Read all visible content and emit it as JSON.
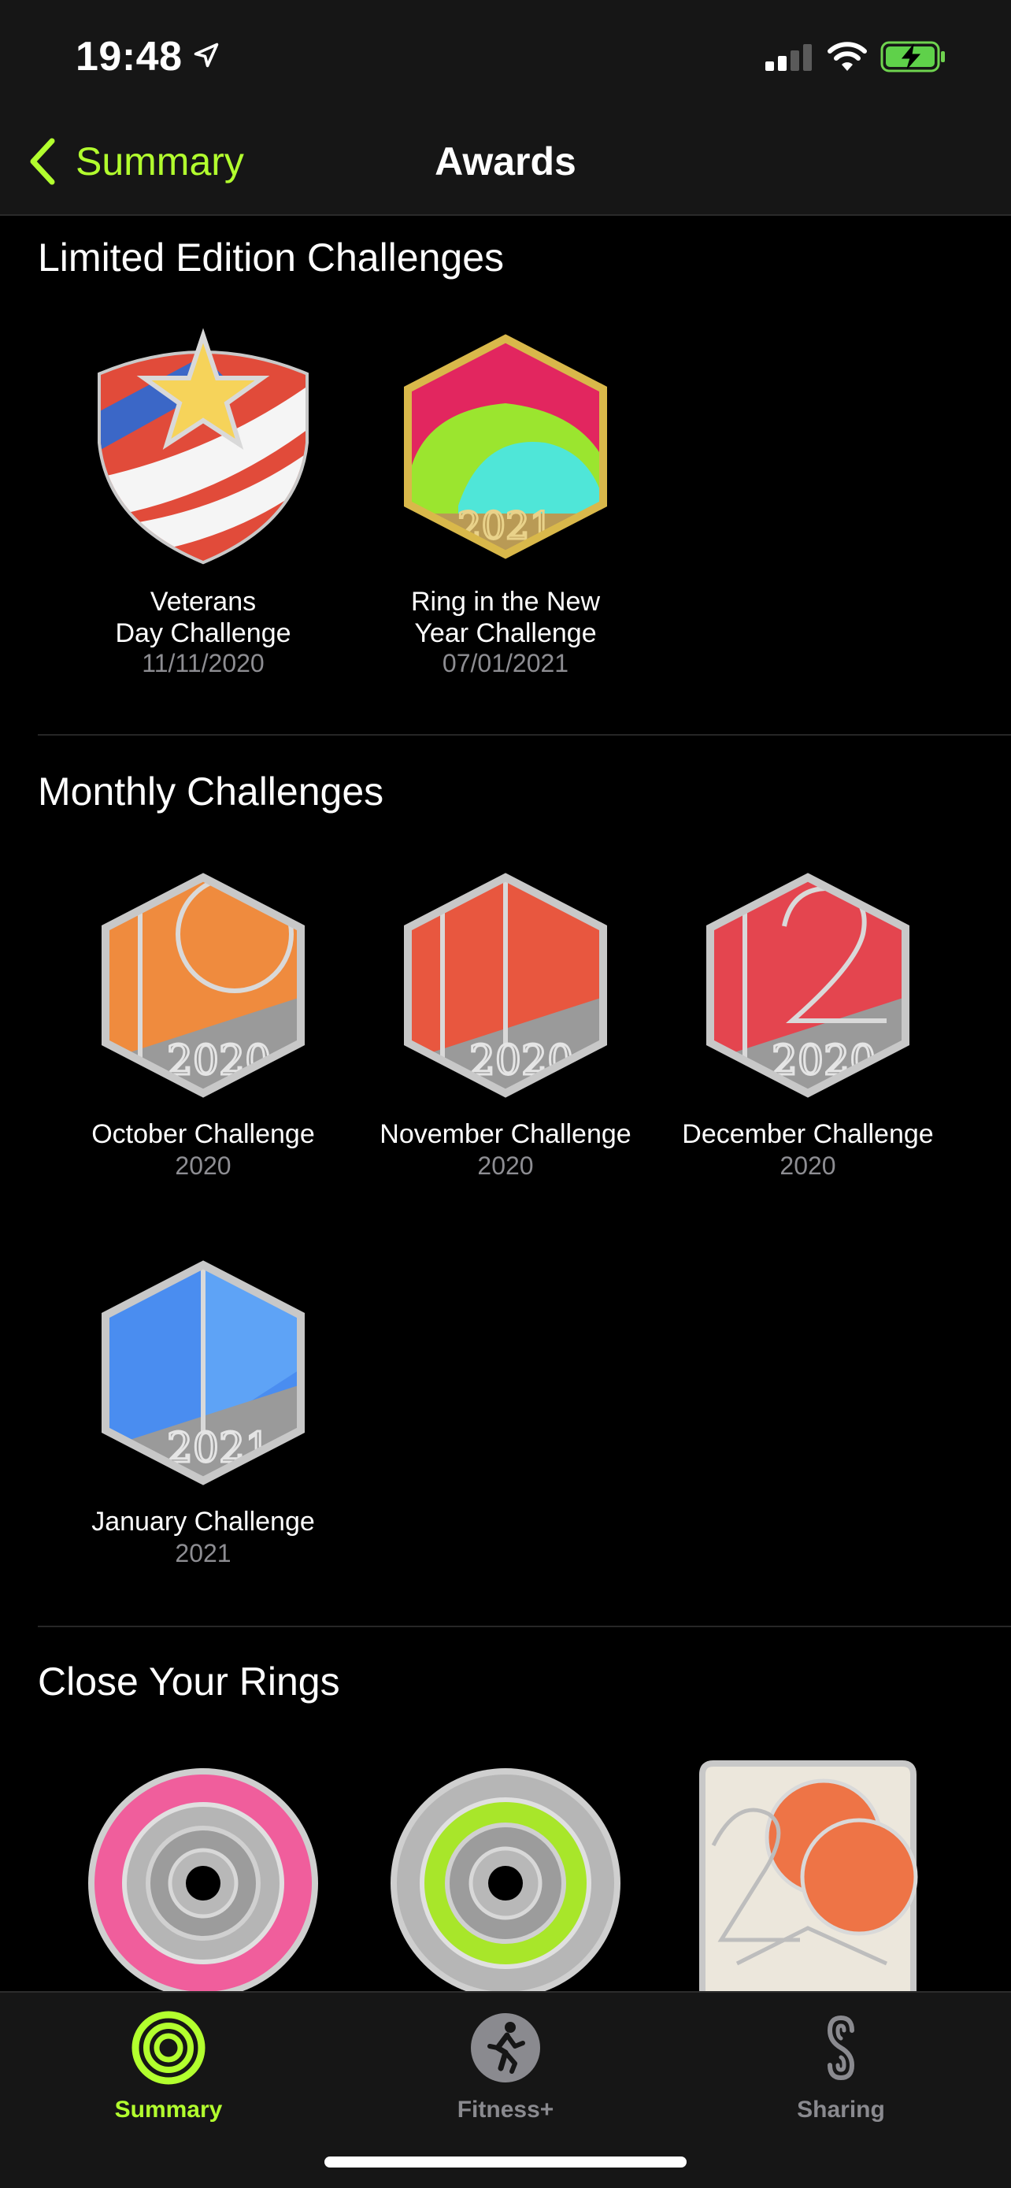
{
  "status_bar": {
    "time": "19:48",
    "location_icon": "location-arrow-icon",
    "signal_icon": "cellular-signal-icon",
    "wifi_icon": "wifi-icon",
    "battery_icon": "battery-charging-icon"
  },
  "nav": {
    "back_label": "Summary",
    "title": "Awards"
  },
  "sections": {
    "limited": {
      "title": "Limited Edition Challenges",
      "badges": [
        {
          "name": "Veterans\nDay Challenge",
          "date": "11/11/2020"
        },
        {
          "name": "Ring in the New\nYear Challenge",
          "date": "07/01/2021"
        }
      ]
    },
    "monthly": {
      "title": "Monthly Challenges",
      "badges": [
        {
          "name": "October Challenge",
          "date": "2020"
        },
        {
          "name": "November Challenge",
          "date": "2020"
        },
        {
          "name": "December Challenge",
          "date": "2020"
        },
        {
          "name": "January Challenge",
          "date": "2021"
        }
      ]
    },
    "rings": {
      "title": "Close Your Rings"
    }
  },
  "tab_bar": {
    "tabs": [
      {
        "label": "Summary",
        "icon": "activity-rings-icon",
        "active": true
      },
      {
        "label": "Fitness+",
        "icon": "runner-icon",
        "active": false
      },
      {
        "label": "Sharing",
        "icon": "sharing-icon",
        "active": false
      }
    ]
  },
  "colors": {
    "accent": "#b2ff2e",
    "background": "#000000",
    "bar_background": "#161616",
    "secondary_text": "#8d8d92"
  }
}
